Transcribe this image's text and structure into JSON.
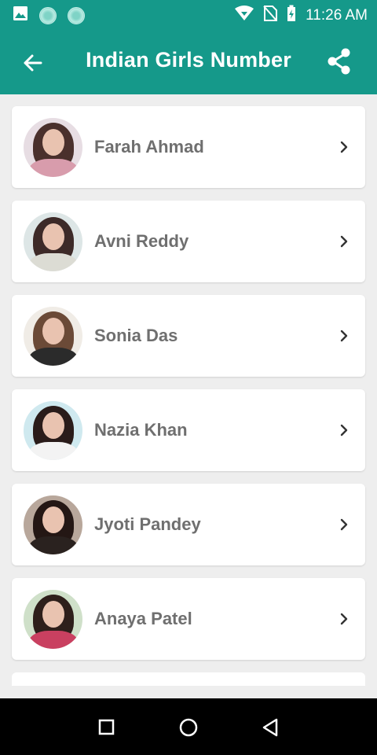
{
  "status_bar": {
    "time": "11:26 AM",
    "icons": [
      "image-icon",
      "notification-dot-icon",
      "notification-dot-icon",
      "wifi-icon",
      "no-sim-icon",
      "battery-charging-icon"
    ]
  },
  "app_bar": {
    "title": "Indian Girls Number",
    "back_icon": "arrow-back-icon",
    "share_icon": "share-icon"
  },
  "contacts": [
    {
      "name": "Farah Ahmad",
      "avatar_bg": "#e7dde3",
      "hair": "#4a302c",
      "body": "#d89cac"
    },
    {
      "name": "Avni Reddy",
      "avatar_bg": "#dde6e6",
      "hair": "#3d2a28",
      "body": "#dcdcd4"
    },
    {
      "name": "Sonia Das",
      "avatar_bg": "#f0ece6",
      "hair": "#6b4a37",
      "body": "#2b2b2b"
    },
    {
      "name": "Nazia Khan",
      "avatar_bg": "#cfe9ef",
      "hair": "#2a1c1a",
      "body": "#f3f3f3"
    },
    {
      "name": "Jyoti Pandey",
      "avatar_bg": "#b8a79b",
      "hair": "#241714",
      "body": "#2a221f"
    },
    {
      "name": "Anaya Patel",
      "avatar_bg": "#cfe0c9",
      "hair": "#2e1f1b",
      "body": "#c94060"
    }
  ],
  "colors": {
    "primary": "#15998a",
    "background": "#eeeeee",
    "name_text": "#6f6f6f"
  },
  "nav_bar": {
    "icons": [
      "recents-square-icon",
      "home-circle-icon",
      "back-triangle-icon"
    ]
  }
}
